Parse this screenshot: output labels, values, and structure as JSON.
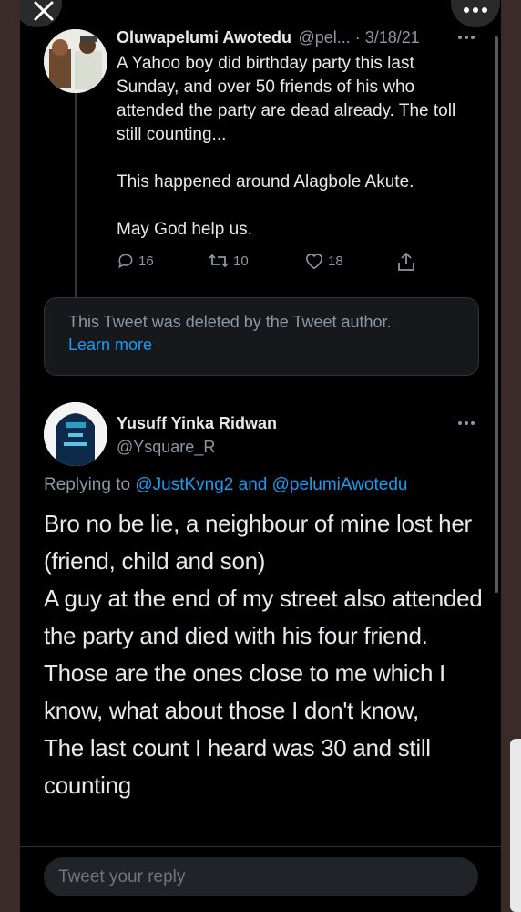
{
  "tweet": {
    "author_name": "Oluwapelumi Awotedu",
    "author_handle_date": "@pel... · 3/18/21",
    "text": "A Yahoo boy did birthday party this last Sunday, and over 50 friends of his who attended the party are dead already. The toll still counting...\n\nThis happened around Alagbole Akute.\n\nMay God help us.",
    "replies": "16",
    "retweets": "10",
    "likes": "18",
    "more_icon": "more-dots-icon"
  },
  "deleted_notice": {
    "text": "This Tweet was deleted by the Tweet author.",
    "link": "Learn more"
  },
  "reply": {
    "author_name": "Yusuff Yinka Ridwan",
    "author_handle": "@Ysquare_R",
    "replying_prefix": "Replying to",
    "mention1": "@JustKvng2",
    "and": "and",
    "mention2": "@pelumiAwotedu",
    "text": "Bro no be lie, a neighbour of mine lost her (friend, child and son)\nA guy at the end of my street also attended the party and died with his four friend. Those are the ones close to me which I know, what about those I don't know,\nThe last count I heard was 30 and still counting"
  },
  "composer": {
    "placeholder": "Tweet your reply"
  },
  "colors": {
    "background": "#000000",
    "link": "#1d9bf0",
    "muted": "#8b98a5"
  }
}
